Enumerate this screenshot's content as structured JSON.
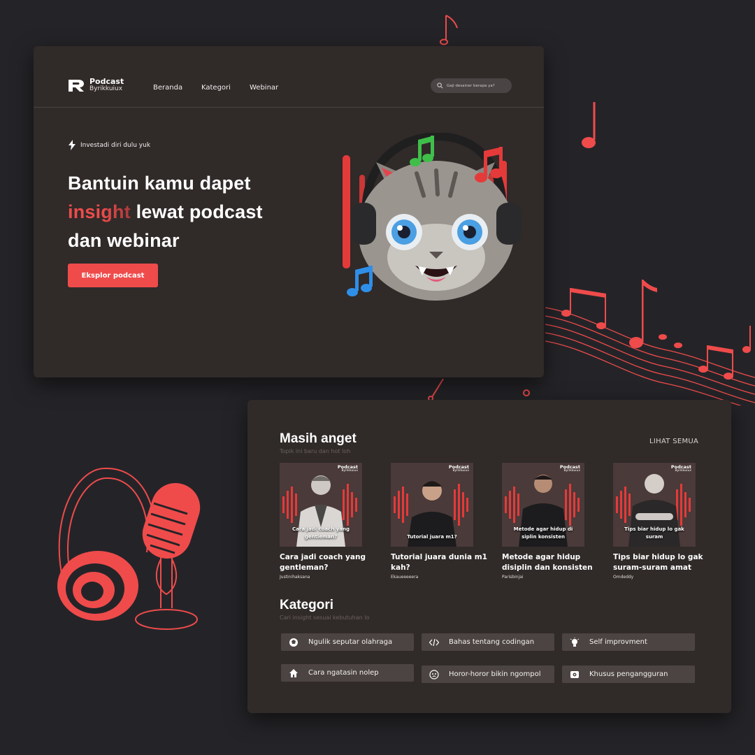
{
  "brand": {
    "name": "Podcast",
    "sub": "Byrikkuiux"
  },
  "nav": {
    "items": [
      "Beranda",
      "Kategori",
      "Webinar"
    ]
  },
  "search": {
    "placeholder": "Gaji desainer berapa ya?"
  },
  "hero": {
    "tagline": "Investadi diri dulu yuk",
    "title_line1": "Bantuin kamu dapet",
    "title_highlight": "insight",
    "title_line2_rest": " lewat podcast",
    "title_line3": "dan webinar",
    "cta": "Eksplor podcast"
  },
  "latest": {
    "title": "Masih anget",
    "subtitle": "Topik ini baru dan hot loh",
    "see_all": "LIHAT SEMUA",
    "cards": [
      {
        "caption": "Cara jadi coach yang gentleman?",
        "title": "Cara jadi coach yang gentleman?",
        "author": "Justinihaksana"
      },
      {
        "caption": "Tutorial juara m1?",
        "title": "Tutorial juara dunia m1 kah?",
        "author": "Ekaueeeeera"
      },
      {
        "caption": "Metode agar hidup di siplin konsisten",
        "title": "Metode agar hidup disiplin dan konsisten",
        "author": "Parisbinjai"
      },
      {
        "caption": "Tips biar hidup lo gak suram",
        "title": "Tips biar hidup lo gak suram-suram amat",
        "author": "Omdeddy"
      }
    ]
  },
  "categories": {
    "title": "Kategori",
    "subtitle": "Cari insight sesuai kebutuhan lo",
    "items": [
      {
        "label": "Ngulik seputar olahraga",
        "icon": "ball-icon"
      },
      {
        "label": "Bahas tentang codingan",
        "icon": "code-icon"
      },
      {
        "label": "Self improvment",
        "icon": "bulb-icon"
      },
      {
        "label": "Cara ngatasin nolep",
        "icon": "home-icon"
      },
      {
        "label": "Horor-horor bikin ngompol",
        "icon": "ghost-icon"
      },
      {
        "label": "Khusus pengangguran",
        "icon": "wallet-icon"
      }
    ]
  },
  "colors": {
    "accent": "#ef4b4b",
    "panel": "#302a29",
    "background": "#242428",
    "chip": "#4c4443"
  }
}
